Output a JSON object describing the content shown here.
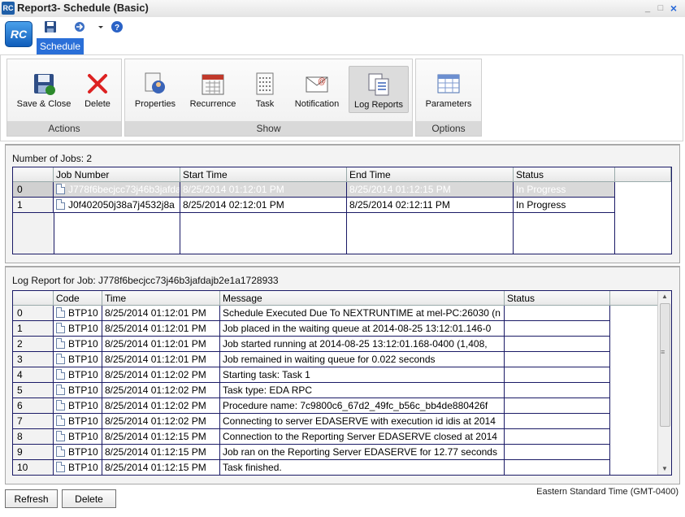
{
  "window": {
    "title": "Report3- Schedule (Basic)",
    "icon_text": "RC"
  },
  "ribbon": {
    "logo_text": "RC",
    "tab": "Schedule",
    "groups": {
      "actions": {
        "label": "Actions",
        "buttons": [
          "Save & Close",
          "Delete"
        ]
      },
      "show": {
        "label": "Show",
        "buttons": [
          "Properties",
          "Recurrence",
          "Task",
          "Notification",
          "Log Reports"
        ]
      },
      "options": {
        "label": "Options",
        "buttons": [
          "Parameters"
        ]
      }
    }
  },
  "jobs": {
    "label": "Number of Jobs: 2",
    "columns": [
      "Job Number",
      "Start Time",
      "End Time",
      "Status"
    ],
    "rows": [
      {
        "idx": "0",
        "job": "J778f6becjcc73j46b3jafdajb2e1a1728933",
        "start": "8/25/2014 01:12:01 PM",
        "end": "8/25/2014 01:12:15 PM",
        "status": "In Progress"
      },
      {
        "idx": "1",
        "job": "J0f402050j38a7j4532j8a",
        "start": "8/25/2014 02:12:01 PM",
        "end": "8/25/2014 02:12:11 PM",
        "status": "In Progress"
      }
    ]
  },
  "log": {
    "label": "Log Report for Job: J778f6becjcc73j46b3jafdajb2e1a1728933",
    "columns": [
      "Code",
      "Time",
      "Message",
      "Status"
    ],
    "rows": [
      {
        "idx": "0",
        "code": "BTP10",
        "time": "8/25/2014 01:12:01 PM",
        "message": "Schedule Executed Due To NEXTRUNTIME at mel-PC:26030 (n",
        "status": ""
      },
      {
        "idx": "1",
        "code": "BTP10",
        "time": "8/25/2014 01:12:01 PM",
        "message": "Job placed in the waiting queue at 2014-08-25 13:12:01.146-0",
        "status": ""
      },
      {
        "idx": "2",
        "code": "BTP10",
        "time": "8/25/2014 01:12:01 PM",
        "message": "Job started running at 2014-08-25 13:12:01.168-0400 (1,408,",
        "status": ""
      },
      {
        "idx": "3",
        "code": "BTP10",
        "time": "8/25/2014 01:12:01 PM",
        "message": "Job remained in waiting queue for 0.022 seconds",
        "status": ""
      },
      {
        "idx": "4",
        "code": "BTP10",
        "time": "8/25/2014 01:12:02 PM",
        "message": "Starting task: Task 1",
        "status": ""
      },
      {
        "idx": "5",
        "code": "BTP10",
        "time": "8/25/2014 01:12:02 PM",
        "message": "Task type: EDA RPC",
        "status": ""
      },
      {
        "idx": "6",
        "code": "BTP10",
        "time": "8/25/2014 01:12:02 PM",
        "message": "Procedure name: 7c9800c6_67d2_49fc_b56c_bb4de880426f",
        "status": ""
      },
      {
        "idx": "7",
        "code": "BTP10",
        "time": "8/25/2014 01:12:02 PM",
        "message": "Connecting to server EDASERVE with execution id idis at 2014",
        "status": ""
      },
      {
        "idx": "8",
        "code": "BTP10",
        "time": "8/25/2014 01:12:15 PM",
        "message": "Connection to the Reporting Server EDASERVE closed at 2014",
        "status": ""
      },
      {
        "idx": "9",
        "code": "BTP10",
        "time": "8/25/2014 01:12:15 PM",
        "message": "Job ran on the Reporting Server EDASERVE for 12.77 seconds",
        "status": ""
      },
      {
        "idx": "10",
        "code": "BTP10",
        "time": "8/25/2014 01:12:15 PM",
        "message": "Task finished.",
        "status": ""
      }
    ]
  },
  "footer": {
    "refresh": "Refresh",
    "delete": "Delete",
    "timezone": "Eastern Standard Time (GMT-0400)"
  }
}
